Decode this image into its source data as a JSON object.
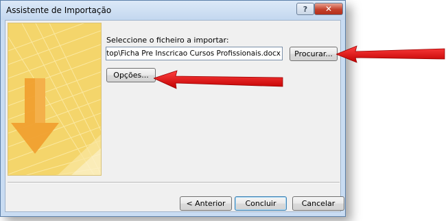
{
  "window": {
    "title": "Assistente de Importação",
    "help_label": "?",
    "close_label": "✕"
  },
  "form": {
    "file_label": "Seleccione o ficheiro a importar:",
    "file_value": "Desktop\\Ficha Pre Inscricao Cursos Profissionais.docx",
    "browse_label": "Procurar...",
    "options_label": "Opções..."
  },
  "footer": {
    "back_label": "< Anterior",
    "finish_label": "Concluir",
    "cancel_label": "Cancelar"
  },
  "colors": {
    "annotation_arrow": "#e01010",
    "graphic_yellow": "#f4d56b",
    "graphic_arrow": "#f0a030"
  }
}
